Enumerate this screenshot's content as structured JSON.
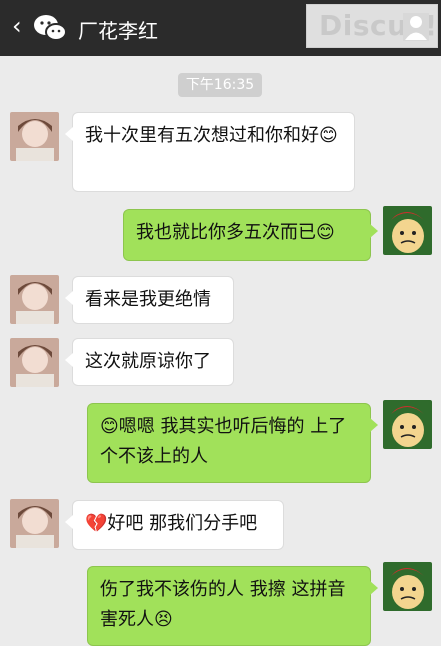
{
  "header": {
    "back_icon": "chevron-left-icon",
    "app_icon": "wechat-icon",
    "title": "厂花李红",
    "watermark": "Discuz!"
  },
  "timestamp": "下午16:35",
  "messages": [
    {
      "side": "left",
      "text": "我十次里有五次想过和你和好",
      "emoji_after": "😊"
    },
    {
      "side": "right",
      "text": "我也就比你多五次而已",
      "emoji_after": "😊"
    },
    {
      "side": "left",
      "text": "看来是我更绝情"
    },
    {
      "side": "left",
      "text": "这次就原谅你了"
    },
    {
      "side": "right",
      "emoji_before": "😊",
      "text": "嗯嗯  我其实也听后悔的 上了个不该上的人"
    },
    {
      "side": "left",
      "emoji_before": "💔",
      "text": "好吧 那我们分手吧"
    },
    {
      "side": "right",
      "text": "伤了我不该伤的人 我擦 这拼音害死人",
      "emoji_after": "😣"
    }
  ],
  "colors": {
    "topbar": "#2b2b2b",
    "background": "#ebebeb",
    "bubble_right": "#a1e15a",
    "bubble_left": "#ffffff"
  }
}
